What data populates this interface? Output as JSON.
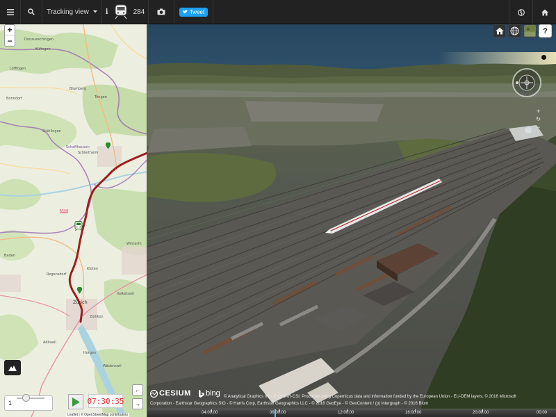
{
  "navbar": {
    "menu_icon": "hamburger-icon",
    "search_icon": "search-icon",
    "view_select": "Tracking view",
    "info_icon": "info-icon",
    "count": "284",
    "camera_icon": "camera-icon",
    "tweet_label": "Tweet",
    "globe_icon": "globe-icon",
    "home_icon": "home-icon"
  },
  "map2d": {
    "zoom_in": "+",
    "zoom_out": "−",
    "labels": [
      {
        "text": "Donaueschingen"
      },
      {
        "text": "Hüfingen"
      },
      {
        "text": "Löffingen"
      },
      {
        "text": "Blumberg"
      },
      {
        "text": "Bonndorf"
      },
      {
        "text": "Tengen"
      },
      {
        "text": "Stühlingen"
      },
      {
        "text": "Schaffhausen"
      },
      {
        "text": "Schleitheim"
      },
      {
        "text": "A50"
      },
      {
        "text": "Winterth"
      },
      {
        "text": "Baden"
      },
      {
        "text": "Regensdorf"
      },
      {
        "text": "Zürich"
      },
      {
        "text": "Zollikon"
      },
      {
        "text": "Adliswil"
      },
      {
        "text": "Horgen"
      },
      {
        "text": "Wädenswil"
      },
      {
        "text": "Kloten"
      },
      {
        "text": "Volketswil"
      }
    ],
    "credit": "Leaflet | © OpenStreetMap contributors"
  },
  "controls": {
    "speed_value": "1",
    "clock": "07:30:35",
    "back_arrow": "←",
    "forward_arrow": "→"
  },
  "view3d": {
    "cesium_logo": "CESIUM",
    "bing_logo": "bing",
    "credit_line1": "© Analytical Graphics Inc., © CGIAR-CSI, Produced using Copernicus data and information funded by the European Union - EU-DEM layers, © 2016 Microsoft",
    "credit_line2": "Corporation - Earthstar Geographics SIO - © Harris Corp, Earthstar Geographics LLC - © 2016 GeoEye - © GeoContent / (p) Intergraph - © 2016 Blom",
    "timeline_labels": [
      "04:00:00",
      "08:00:00",
      "12:00:00",
      "16:00:00",
      "20:00:00",
      "00:00"
    ]
  },
  "colors": {
    "navbar_bg": "#222222",
    "track": "#a01818",
    "clock_text": "#e33333",
    "tweet": "#1da1f2"
  }
}
